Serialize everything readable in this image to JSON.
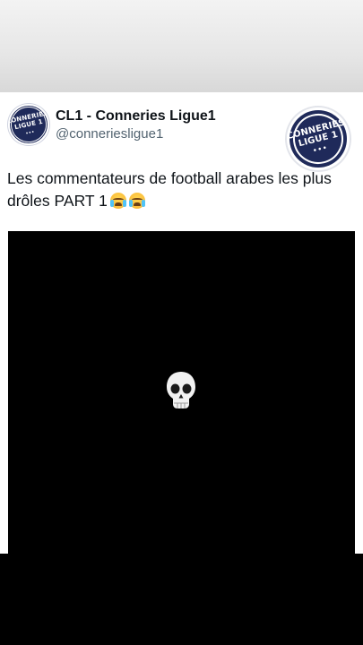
{
  "tweet": {
    "display_name": "CL1 - Conneries Ligue1",
    "handle": "@conneriesligue1",
    "text": "Les commentateurs de football arabes les plus drôles PART 1",
    "trailing_emojis": [
      "loudly-crying-face",
      "loudly-crying-face"
    ],
    "avatar": {
      "logo_line1": "CONNERIES",
      "logo_line2": "LIGUE 1"
    },
    "corner_logo": {
      "logo_line1": "CONNERIES",
      "logo_line2": "LIGUE 1"
    }
  },
  "media": {
    "background": "#000000",
    "center_icon": "skull-icon"
  },
  "colors": {
    "brand_navy": "#1f2a5a",
    "text_primary": "#0f1419",
    "text_secondary": "#536471"
  }
}
